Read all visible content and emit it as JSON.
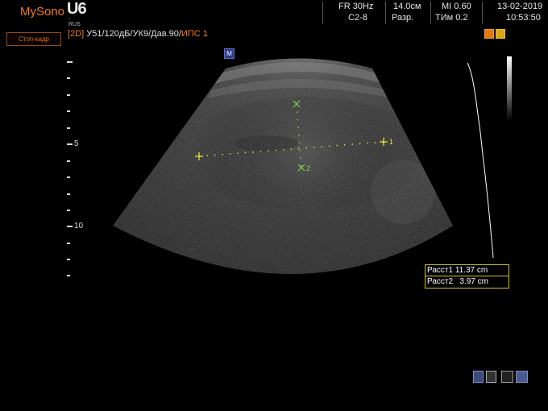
{
  "brand": {
    "name": "MySono",
    "model": "U6",
    "region": "-RUS"
  },
  "header": {
    "fr": "FR 30Hz",
    "probe": "C2-8",
    "depth": "14.0см",
    "res": "Разр.",
    "mi": "MI  0.60",
    "tim": "ТИм 0.2",
    "date": "13-02-2019",
    "time": "10:53:50"
  },
  "freeze_button": "Стоп-кадр",
  "status": {
    "mode": "[2D]",
    "gain": " У51",
    "dr": "/120дБ/",
    "uk": "УК9",
    "dav": "/Дав.90/",
    "ips": "ИПС 1"
  },
  "depth_labels": {
    "d5": "5",
    "d10": "10"
  },
  "cursor_marker": "M",
  "calipers": {
    "c1": "1",
    "c2": "2"
  },
  "measurements": [
    {
      "label": "Расст1",
      "value": "11.37 cm"
    },
    {
      "label": "Расст2",
      "value": "3.97 cm"
    }
  ],
  "colors": {
    "accent": "#f47a1f",
    "caliper": "#d8e030",
    "caliper_b": "#7fd04a",
    "box": "#d8c020"
  },
  "icons": [
    "preset-icon",
    "lock-icon",
    "storage-icon",
    "network-icon",
    "usb-icon",
    "printer-icon"
  ]
}
